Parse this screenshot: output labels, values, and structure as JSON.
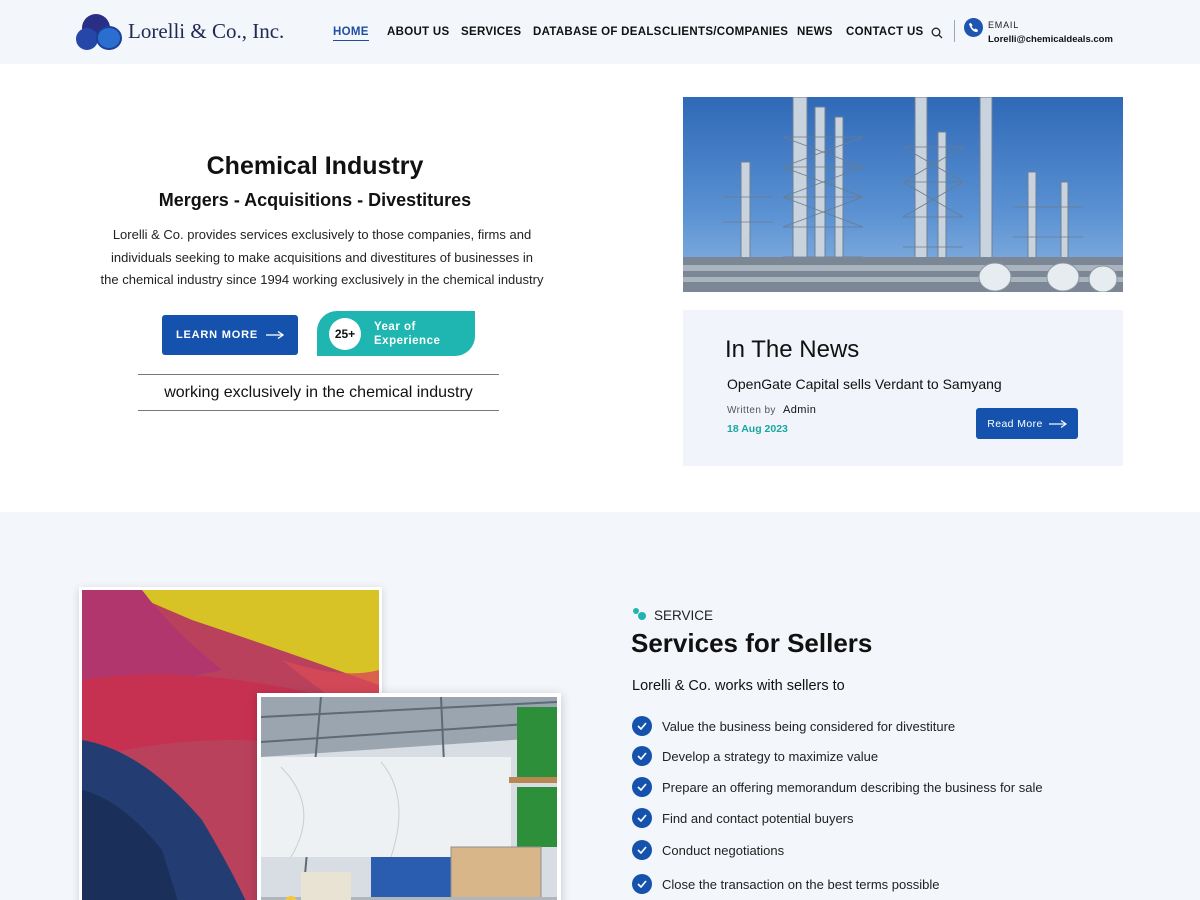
{
  "header": {
    "logo_text": "Lorelli & Co., Inc.",
    "nav": [
      "HOME",
      "ABOUT US",
      "SERVICES",
      "DATABASE OF DEALS",
      "CLIENTS/COMPANIES",
      "NEWS",
      "CONTACT US"
    ],
    "active_nav": "HOME",
    "email_label": "EMAIL",
    "email_value": "Lorelli@chemicaldeals.com"
  },
  "hero": {
    "title": "Chemical Industry",
    "subtitle": "Mergers - Acquisitions - Divestitures",
    "description_lines": [
      "Lorelli & Co. provides services exclusively to those companies, firms and",
      "individuals seeking to make acquisitions and divestitures of businesses in",
      "the chemical industry since 1994 working exclusively in the chemical industry"
    ],
    "learn_more_label": "LEARN MORE",
    "experience_number": "25+",
    "experience_label_1": "Year of",
    "experience_label_2": "Experience",
    "tagline": "working exclusively in the chemical industry"
  },
  "news": {
    "title": "In The News",
    "headline": "OpenGate Capital sells Verdant to Samyang",
    "written_by_label": "Written by",
    "author": "Admin",
    "date": "18 Aug 2023",
    "read_more_label": "Read More"
  },
  "services": {
    "eyebrow": "SERVICE",
    "title": "Services for Sellers",
    "intro": "Lorelli & Co. works with sellers to",
    "items": [
      "Value the business being considered for divestiture",
      "Develop a strategy to maximize value",
      "Prepare an offering memorandum describing the business for sale",
      "Find and contact potential buyers",
      "Conduct negotiations",
      "Close the transaction on the best terms possible"
    ]
  },
  "colors": {
    "primary_blue": "#1552ad",
    "teal": "#1fb5b0",
    "section_bg": "#f3f6fb"
  }
}
